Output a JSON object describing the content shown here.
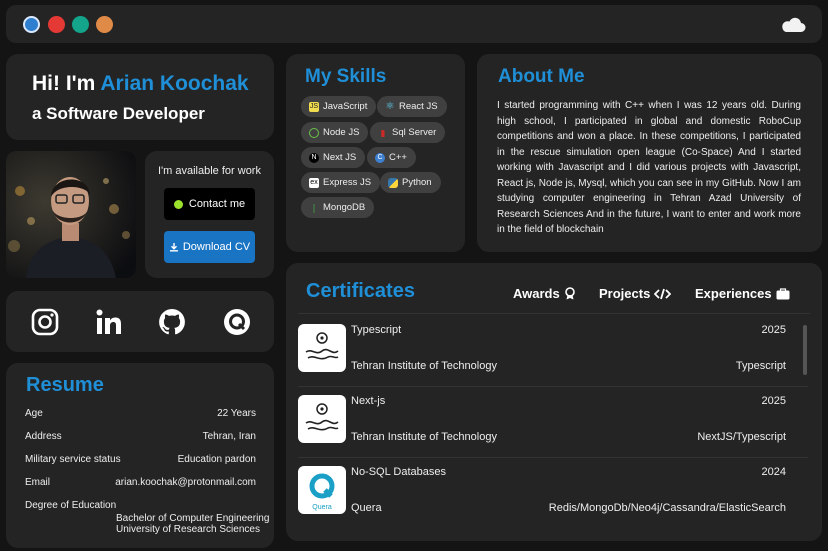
{
  "window": {
    "dots": [
      "#2f7fd1",
      "#e53935",
      "#14a38b",
      "#e08a48"
    ],
    "theme_icon": "cloud-icon"
  },
  "hero": {
    "greeting": "Hi! I'm",
    "name": "Arian Koochak",
    "role": "a Software Developer"
  },
  "availability": {
    "message": "I'm available for work",
    "contact_label": "Contact me",
    "cv_label": "Download CV"
  },
  "social": [
    "instagram-icon",
    "linkedin-icon",
    "github-icon",
    "quera-icon"
  ],
  "resume": {
    "title": "Resume",
    "rows": [
      {
        "key": "Age",
        "value": "22 Years"
      },
      {
        "key": "Address",
        "value": "Tehran, Iran"
      },
      {
        "key": "Military service status",
        "value": "Education pardon"
      },
      {
        "key": "Email",
        "value": "arian.koochak@protonmail.com"
      },
      {
        "key": "Degree of Education",
        "value": ""
      }
    ],
    "education_line1": "Bachelor of Computer Engineering",
    "education_line2": "University of Research Sciences"
  },
  "skills": {
    "title": "My Skills",
    "items": [
      "JavaScript",
      "React JS",
      "Node JS",
      "Sql Server",
      "Next JS",
      "C++",
      "Express JS",
      "Python",
      "MongoDB"
    ]
  },
  "about": {
    "title": "About Me",
    "text": "I started programming with C++ when I was 12 years old. During high school, I participated in global and domestic RoboCup competitions and won a place. In these competitions, I participated in the rescue simulation open league (Co-Space) And I started working with Javascript and I did various projects with Javascript, React js, Node js, Mysql, which you can see in my GitHub. Now I am studying computer engineering in Tehran Azad University of Research Sciences And in the future, I want to enter and work more in the field of blockchain"
  },
  "certificates": {
    "title": "Certificates",
    "tabs": [
      "Awards",
      "Projects",
      "Experiences"
    ],
    "items": [
      {
        "title": "Typescript",
        "year": "2025",
        "institute": "Tehran Institute of Technology",
        "tag": "Typescript"
      },
      {
        "title": "Next-js",
        "year": "2025",
        "institute": "Tehran Institute of Technology",
        "tag": "NextJS/Typescript"
      },
      {
        "title": "No-SQL Databases",
        "year": "2024",
        "institute": "Quera",
        "tag": "Redis/MongoDb/Neo4j/Cassandra/ElasticSearch"
      }
    ],
    "quera_logo_text": "Quera"
  }
}
